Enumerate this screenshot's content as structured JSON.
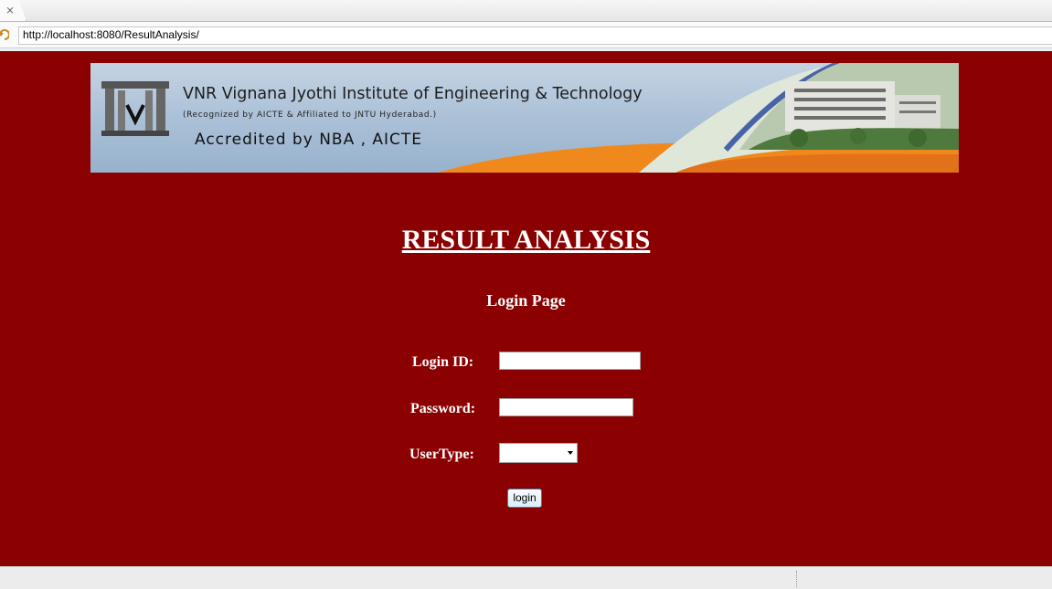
{
  "browser": {
    "tab_close_glyph": "⨯",
    "url": "http://localhost:8080/ResultAnalysis/"
  },
  "banner": {
    "institute_name": "VNR Vignana Jyothi Institute of Engineering & Technology",
    "recognition": "(Recognized by AICTE & Affiliated to JNTU Hyderabad.)",
    "accreditation": "Accredited by NBA , AICTE"
  },
  "page": {
    "title": "RESULT ANALYSIS",
    "subtitle": "Login Page",
    "background_color": "#8b0000"
  },
  "form": {
    "login_id_label": "Login ID:",
    "login_id_value": "",
    "password_label": "Password:",
    "password_value": "",
    "usertype_label": "UserType:",
    "usertype_selected": "",
    "login_button": "login"
  }
}
